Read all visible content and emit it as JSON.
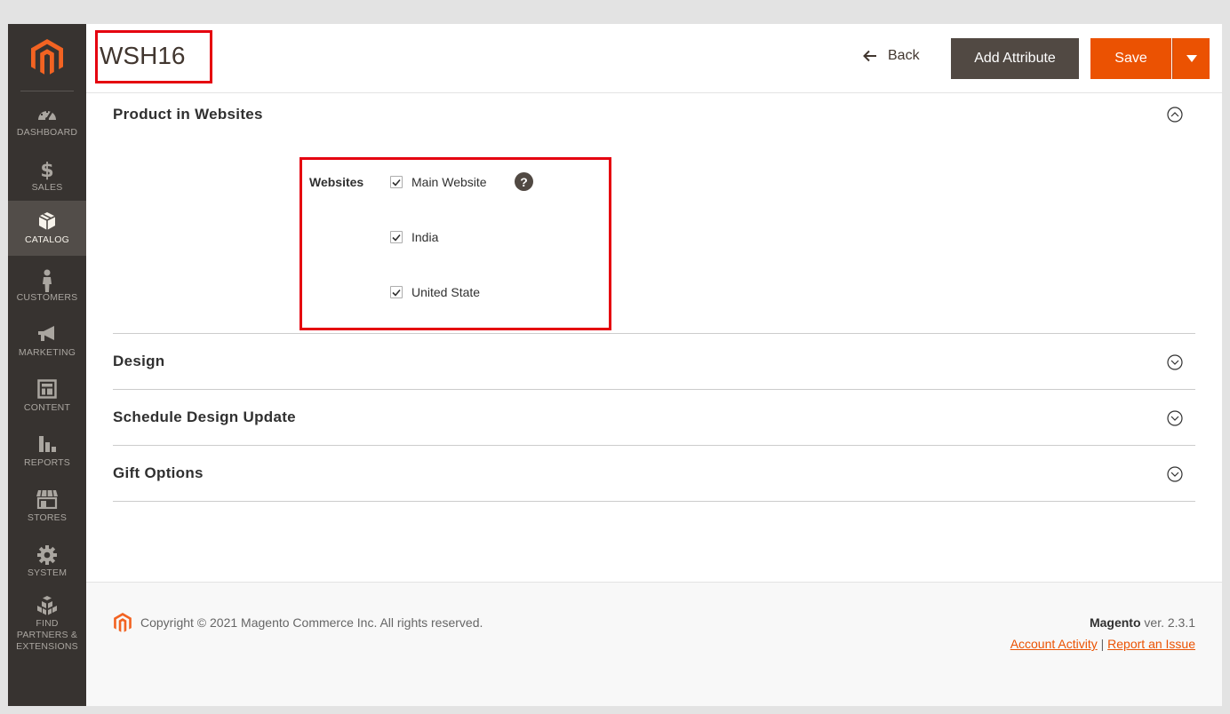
{
  "colors": {
    "accent": "#eb5202",
    "sidebar_bg": "#373330",
    "sidebar_active": "#524d49",
    "highlight_box": "#e5000f"
  },
  "sidebar": {
    "logo_icon": "magento-logo-icon",
    "items": [
      {
        "label": "DASHBOARD",
        "icon": "speedometer-icon",
        "active": false
      },
      {
        "label": "SALES",
        "icon": "dollar-icon",
        "active": false
      },
      {
        "label": "CATALOG",
        "icon": "cube-icon",
        "active": true
      },
      {
        "label": "CUSTOMERS",
        "icon": "person-icon",
        "active": false
      },
      {
        "label": "MARKETING",
        "icon": "megaphone-icon",
        "active": false
      },
      {
        "label": "CONTENT",
        "icon": "layout-icon",
        "active": false
      },
      {
        "label": "REPORTS",
        "icon": "bar-chart-icon",
        "active": false
      },
      {
        "label": "STORES",
        "icon": "storefront-icon",
        "active": false
      },
      {
        "label": "SYSTEM",
        "icon": "gear-icon",
        "active": false
      },
      {
        "label": "FIND PARTNERS & EXTENSIONS",
        "icon": "boxes-icon",
        "active": false
      }
    ]
  },
  "header": {
    "title": "WSH16",
    "back_label": "Back",
    "add_attribute_label": "Add Attribute",
    "save_label": "Save"
  },
  "sections": {
    "product_in_websites": {
      "title": "Product in Websites",
      "expanded": true,
      "field_label": "Websites",
      "help_glyph": "?",
      "websites": [
        {
          "label": "Main Website",
          "checked": true
        },
        {
          "label": "India",
          "checked": true
        },
        {
          "label": "United State",
          "checked": true
        }
      ]
    },
    "design": {
      "title": "Design",
      "expanded": false
    },
    "schedule_design_update": {
      "title": "Schedule Design Update",
      "expanded": false
    },
    "gift_options": {
      "title": "Gift Options",
      "expanded": false
    }
  },
  "footer": {
    "copyright": "Copyright © 2021 Magento Commerce Inc. All rights reserved.",
    "brand": "Magento",
    "version": "ver. 2.3.1",
    "account_activity": "Account Activity",
    "separator": "|",
    "report_issue": "Report an Issue"
  }
}
